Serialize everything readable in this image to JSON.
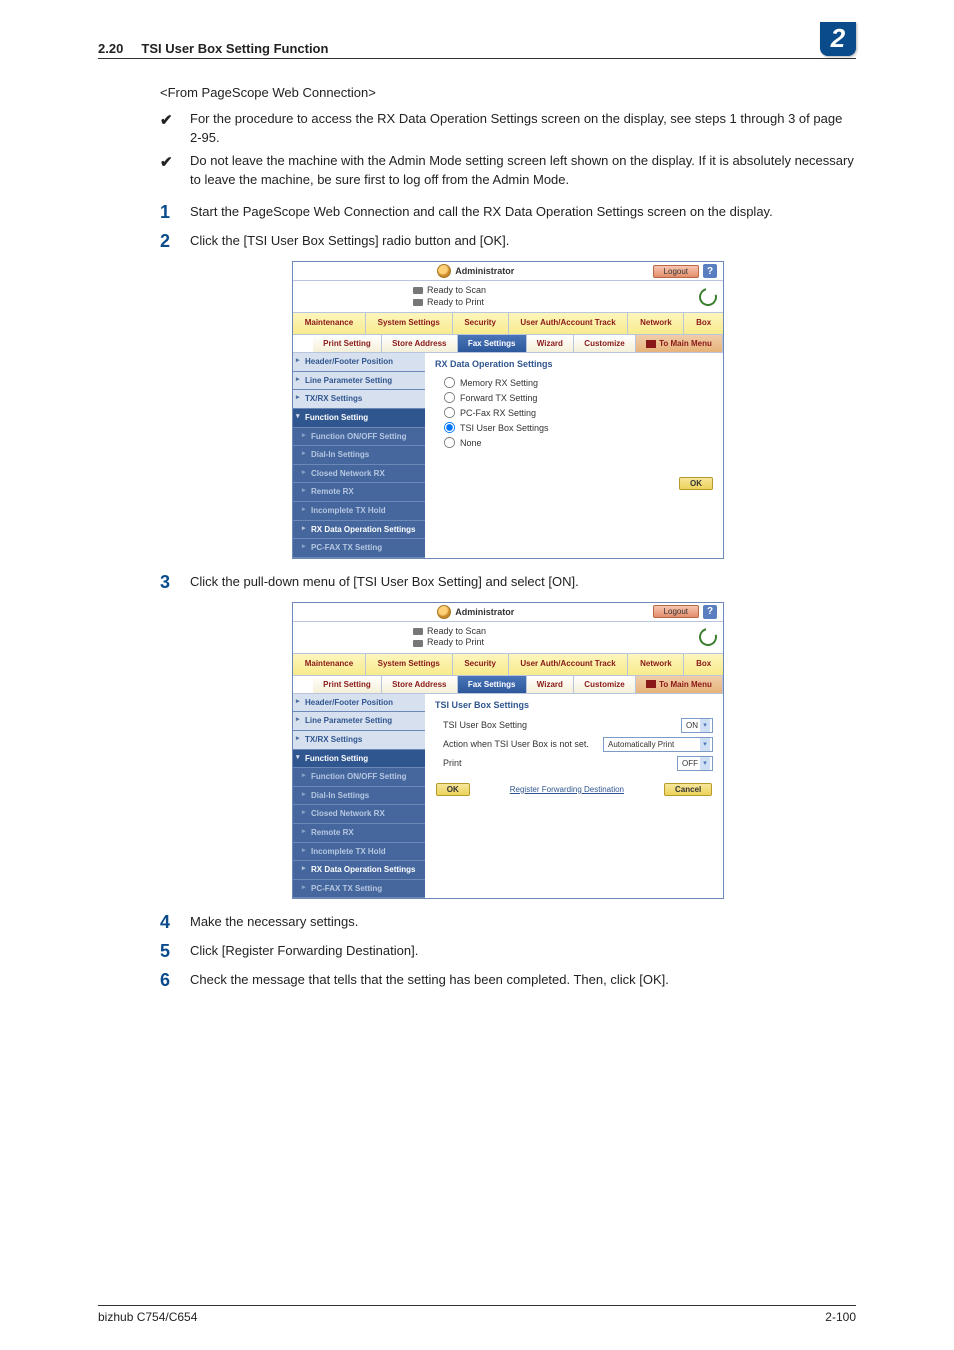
{
  "header": {
    "section_num": "2.20",
    "section_title": "TSI User Box Setting Function",
    "badge": "2"
  },
  "intro": "<From PageScope Web Connection>",
  "checks": [
    "For the procedure to access the RX Data Operation Settings screen on the display, see steps 1 through 3 of page 2-95.",
    "Do not leave the machine with the Admin Mode setting screen left shown on the display. If it is absolutely necessary to leave the machine, be sure first to log off from the Admin Mode."
  ],
  "steps": {
    "s1": "Start the PageScope Web Connection and call the RX Data Operation Settings screen on the display.",
    "s2": "Click the [TSI User Box Settings] radio button and [OK].",
    "s3": "Click the pull-down menu of [TSI User Box Setting] and select [ON].",
    "s4": "Make the necessary settings.",
    "s5": "Click [Register Forwarding Destination].",
    "s6": "Check the message that tells that the setting has been completed. Then, click [OK]."
  },
  "shot": {
    "admin": "Administrator",
    "logout": "Logout",
    "ready_scan": "Ready to Scan",
    "ready_print": "Ready to Print",
    "main_tabs": {
      "maintenance": "Maintenance",
      "system": "System Settings",
      "security": "Security",
      "user": "User Auth/Account Track",
      "network": "Network",
      "box": "Box"
    },
    "sub_tabs": {
      "print": "Print Setting",
      "store": "Store Address",
      "fax": "Fax Settings",
      "wizard": "Wizard",
      "customize": "Customize",
      "tomain": "To Main Menu"
    },
    "side": {
      "header_footer": "Header/Footer Position",
      "line_param": "Line Parameter Setting",
      "txrx": "TX/RX Settings",
      "func": "Function Setting",
      "func_onoff": "Function ON/OFF Setting",
      "dialin": "Dial-In Settings",
      "closed": "Closed Network RX",
      "remote": "Remote RX",
      "incomplete": "Incomplete TX Hold",
      "rxdata": "RX Data Operation Settings",
      "pcfax": "PC-FAX TX Setting"
    },
    "pane1": {
      "title": "RX Data Operation Settings",
      "r1": "Memory RX Setting",
      "r2": "Forward TX Setting",
      "r3": "PC-Fax RX Setting",
      "r4": "TSI User Box Settings",
      "r5": "None",
      "ok": "OK"
    },
    "pane2": {
      "title": "TSI User Box Settings",
      "row1_label": "TSI User Box Setting",
      "row1_val": "ON",
      "row2_label": "Action when TSI User Box is not set.",
      "row2_val": "Automatically Print",
      "row3_label": "Print",
      "row3_val": "OFF",
      "ok": "OK",
      "reg": "Register Forwarding Destination",
      "cancel": "Cancel"
    }
  },
  "footer": {
    "left": "bizhub C754/C654",
    "right": "2-100"
  }
}
